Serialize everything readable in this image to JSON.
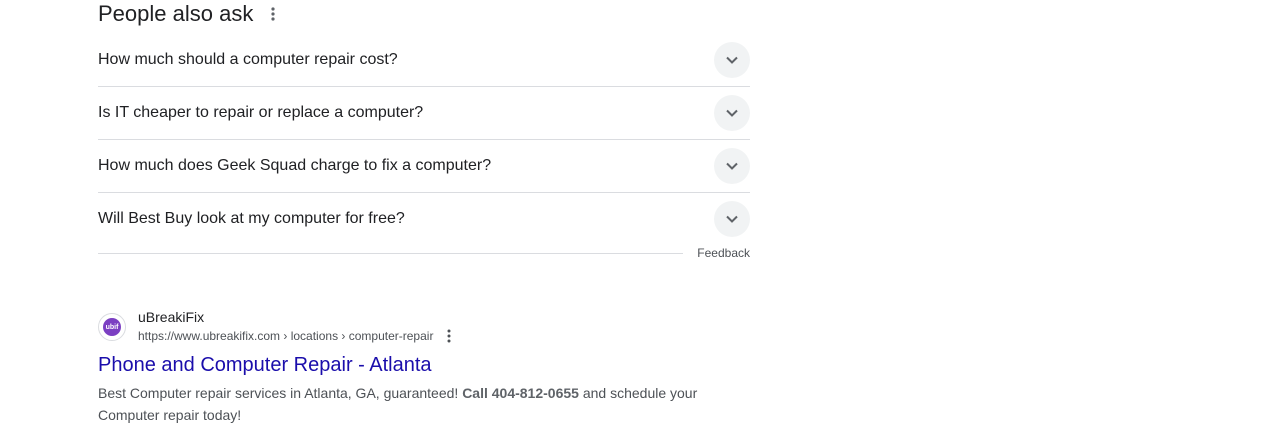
{
  "paa": {
    "title": "People also ask",
    "questions": [
      "How much should a computer repair cost?",
      "Is IT cheaper to repair or replace a computer?",
      "How much does Geek Squad charge to fix a computer?",
      "Will Best Buy look at my computer for free?"
    ],
    "feedback": "Feedback"
  },
  "result": {
    "favicon_text": "ubif",
    "site_name": "uBreakiFix",
    "url": "https://www.ubreakifix.com › locations › computer-repair",
    "title": "Phone and Computer Repair - Atlanta",
    "snippet_pre": "Best Computer repair services in Atlanta, GA, guaranteed! ",
    "snippet_bold": "Call 404-812-0655",
    "snippet_post": " and schedule your Computer repair today!"
  },
  "colors": {
    "link": "#1a0dab",
    "favicon": "#7b3fc2"
  },
  "icons": {
    "more": "more-vert-icon",
    "expand": "chevron-down-icon"
  }
}
